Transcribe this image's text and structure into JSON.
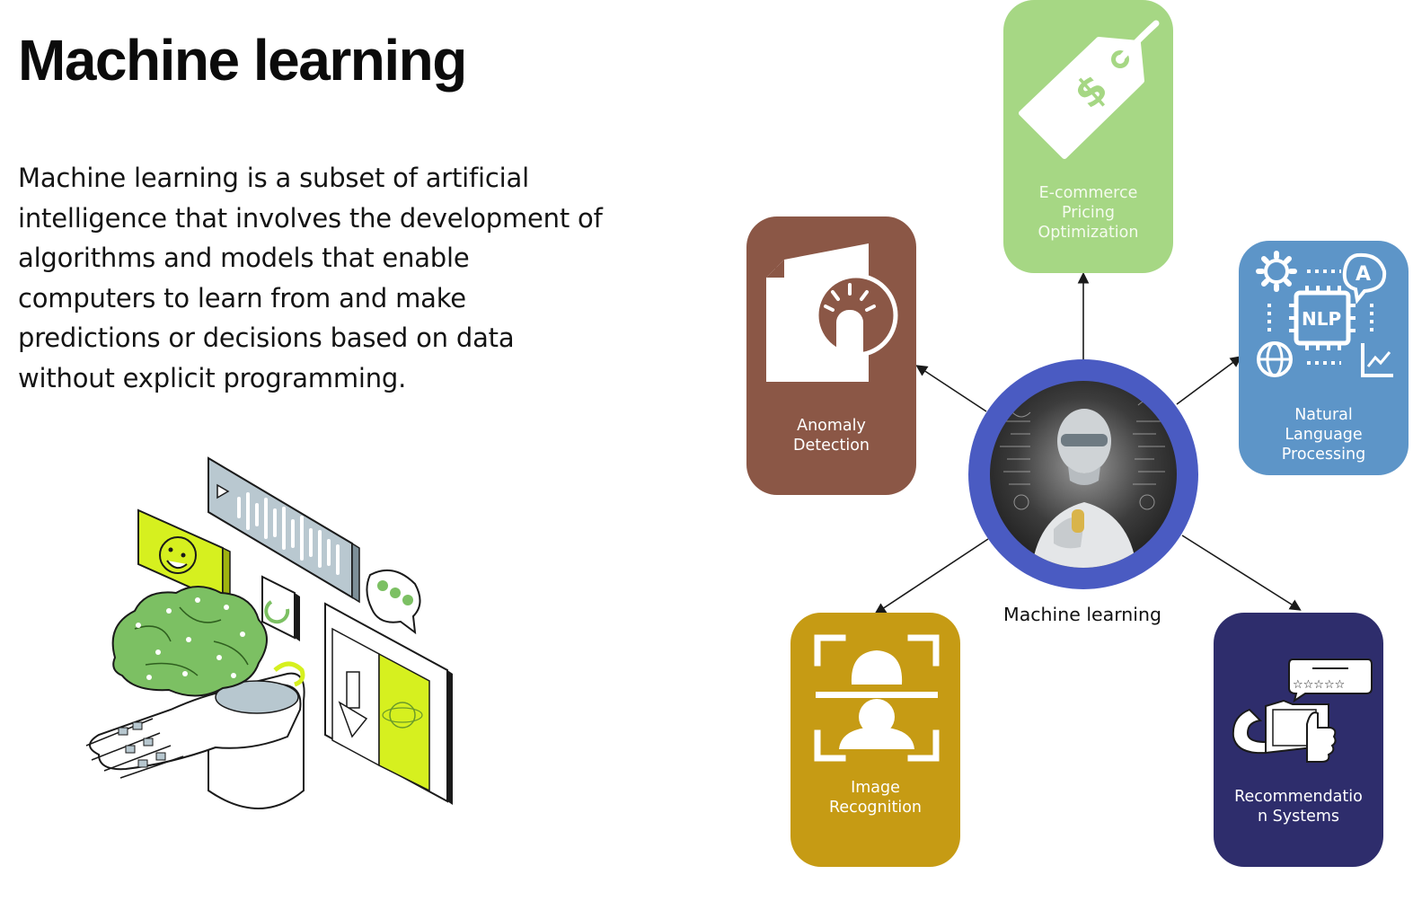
{
  "header": {
    "title": "Machine learning"
  },
  "description": "Machine learning is a subset of artificial intelligence that involves the development of algorithms and models that enable computers to learn from and make predictions or decisions based on data without explicit programming.",
  "diagram": {
    "center_label": "Machine learning",
    "nodes": [
      {
        "id": "pricing",
        "label": "E-commerce\nPricing\nOptimization",
        "color": "#a6d784",
        "icon": "price-tag-icon"
      },
      {
        "id": "anomaly",
        "label": "Anomaly\nDetection",
        "color": "#8b5746",
        "icon": "document-click-icon"
      },
      {
        "id": "nlp",
        "label": "Natural\nLanguage\nProcessing",
        "color": "#5d95c8",
        "icon": "nlp-chip-icon"
      },
      {
        "id": "image",
        "label": "Image\nRecognition",
        "color": "#c69b14",
        "icon": "face-scan-icon"
      },
      {
        "id": "recommend",
        "label": "Recommendatio\nn Systems",
        "color": "#2e2d6c",
        "icon": "rating-thumbs-up-icon"
      }
    ],
    "hub_ring_color": "#4a5bc2"
  },
  "colors": {
    "illustration_green": "#7cc063",
    "illustration_lime": "#d6f01f",
    "illustration_blue": "#b7c7cf"
  }
}
